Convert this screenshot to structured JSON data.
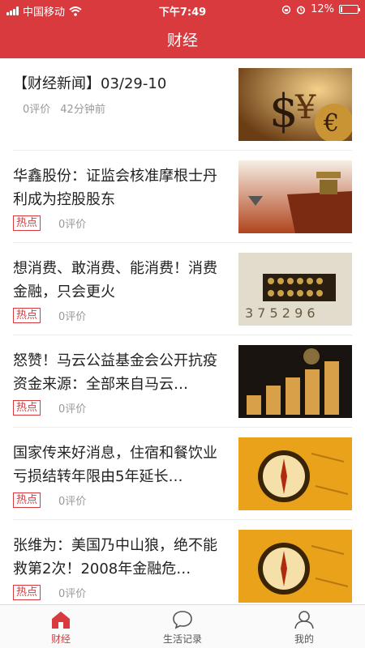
{
  "status_bar": {
    "carrier": "中国移动",
    "time": "下午7:49",
    "battery": "12%",
    "battery_level": 0.12
  },
  "header": {
    "title": "财经"
  },
  "feed": [
    {
      "title": "【财经新闻】03/29-10",
      "comments": "0评价",
      "time_ago": "42分钟前",
      "image": "currency-symbols"
    },
    {
      "title": "华鑫股份：证监会核准摩根士丹利成为控股股东",
      "hot": "热点",
      "comments": "0评价",
      "image": "bronze-vessel"
    },
    {
      "title": "想消费、敢消费、能消费！消费金融，只会更火",
      "hot": "热点",
      "comments": "0评价",
      "image": "abacus-numbers"
    },
    {
      "title": "怒赞！马云公益基金会公开抗疫资金来源：全部来自马云…",
      "hot": "热点",
      "comments": "0评价",
      "image": "coin-stacks"
    },
    {
      "title": "国家传来好消息，住宿和餐饮业亏损结转年限由5年延长…",
      "hot": "热点",
      "comments": "0评价",
      "image": "compass-map"
    },
    {
      "title": "张维为：美国乃中山狼，绝不能救第2次！2008年金融危…",
      "hot": "热点",
      "comments": "0评价",
      "image": "compass-map"
    }
  ],
  "tabbar": {
    "items": [
      {
        "label": "财经",
        "icon": "home-icon",
        "active": true
      },
      {
        "label": "生活记录",
        "icon": "chat-bubble-icon",
        "active": false
      },
      {
        "label": "我的",
        "icon": "user-icon",
        "active": false
      }
    ]
  },
  "colors": {
    "brand": "#d83a3e",
    "hot": "#d83a3e",
    "meta": "#999999"
  }
}
